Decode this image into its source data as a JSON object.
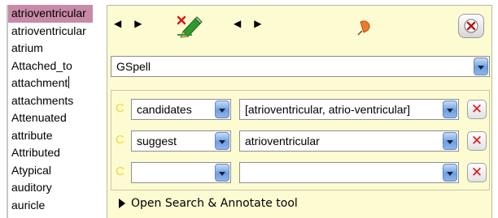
{
  "wordlist": {
    "items": [
      "atrioventricular",
      "atrioventricular",
      "atrium",
      "Attached_to",
      "attachment",
      "attachments",
      "Attenuated",
      "attribute",
      "Attributed",
      "Atypical",
      "auditory",
      "auricle"
    ],
    "selected_index": 0
  },
  "toolbar": {
    "prev_icon": "left-arrow",
    "next_icon": "right-arrow",
    "edit_icon": "pencil-with-red-x",
    "pin_icon": "orange-pushpin",
    "close_icon": "close-x"
  },
  "tool_selector": {
    "value": "GSpell"
  },
  "rules": [
    {
      "marker": "C",
      "field": "candidates",
      "value": "[atrioventricular, atrio-ventricular]"
    },
    {
      "marker": "C",
      "field": "suggest",
      "value": "atrioventricular"
    },
    {
      "marker": "C",
      "field": "",
      "value": ""
    }
  ],
  "footer": {
    "open_tool_label": "Open Search & Annotate tool"
  },
  "colors": {
    "panel_bg": "#fdfbd2",
    "selection": "#c98aa7",
    "delete_red": "#e01414",
    "marker_yellow": "#f2d63f"
  }
}
